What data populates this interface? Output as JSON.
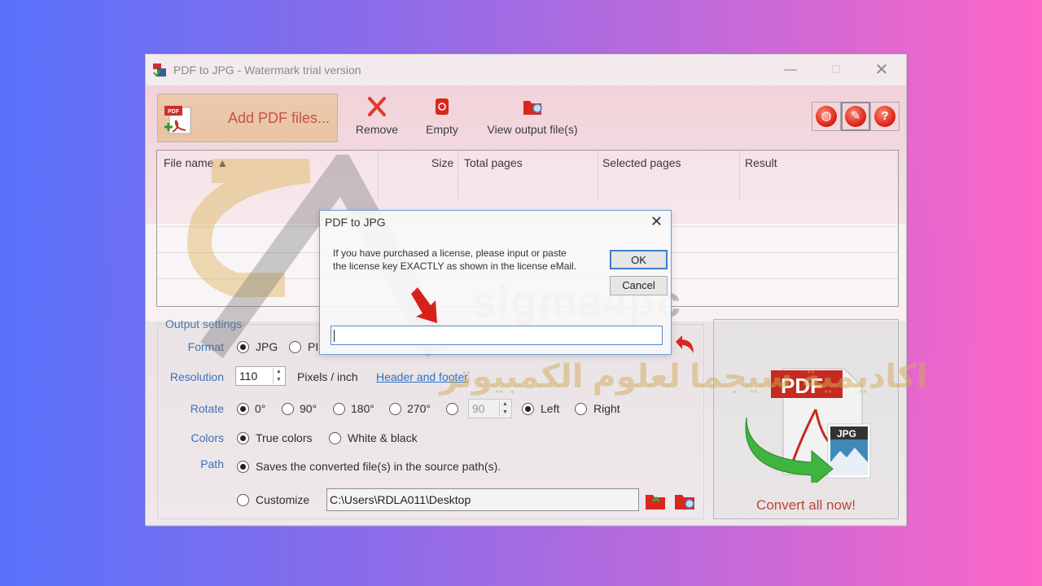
{
  "window": {
    "title": "PDF to JPG - Watermark trial version",
    "controls": {
      "minimize": "—",
      "maximize": "☐",
      "close": "✕"
    }
  },
  "toolbar": {
    "add_pdf_label": "Add PDF files...",
    "remove_label": "Remove",
    "empty_label": "Empty",
    "view_output_label": "View output file(s)",
    "round_buttons": [
      {
        "name": "language",
        "glyph": "◍"
      },
      {
        "name": "settings",
        "glyph": "✎"
      },
      {
        "name": "help",
        "glyph": "?"
      }
    ]
  },
  "file_table": {
    "columns": [
      "File name ▲",
      "Size",
      "Total pages",
      "Selected pages",
      "Result"
    ],
    "rows": []
  },
  "settings": {
    "group_label": "Output settings",
    "format": {
      "label": "Format",
      "options": [
        "JPG",
        "PNG"
      ],
      "selected": "JPG",
      "visible_second": "PI"
    },
    "resolution": {
      "label": "Resolution",
      "value": "110",
      "unit": "Pixels / inch",
      "link": "Header and footer"
    },
    "rotate": {
      "label": "Rotate",
      "options": [
        "0°",
        "90°",
        "180°",
        "270°"
      ],
      "selected": "0°",
      "custom_value": "90",
      "direction_options": [
        "Left",
        "Right"
      ],
      "direction_selected": "Left"
    },
    "colors": {
      "label": "Colors",
      "options": [
        "True colors",
        "White & black"
      ],
      "selected": "True colors"
    },
    "path": {
      "label": "Path",
      "source_option": "Saves the converted file(s) in the source path(s).",
      "customize_option": "Customize",
      "selected": "source",
      "custom_path": "C:\\Users\\RDLA011\\Desktop"
    }
  },
  "convert": {
    "label": "Convert all now!",
    "pdf_badge": "PDF",
    "jpg_badge": "JPG"
  },
  "dialog": {
    "title": "PDF to JPG",
    "close": "✕",
    "message": "If you have purchased a license, please input or paste the license key EXACTLY as shown in the license eMail.",
    "ok_label": "OK",
    "cancel_label": "Cancel",
    "license_value": ""
  },
  "watermark": {
    "site": "sigma4pc",
    "arabic": "اكاديمية سيجما لعلوم الكمبيوتر"
  },
  "colors": {
    "accent_red": "#e02a1e",
    "label_blue": "#3b72b6",
    "link_blue": "#2f6fc0",
    "dialog_border": "#6b9fd6"
  }
}
